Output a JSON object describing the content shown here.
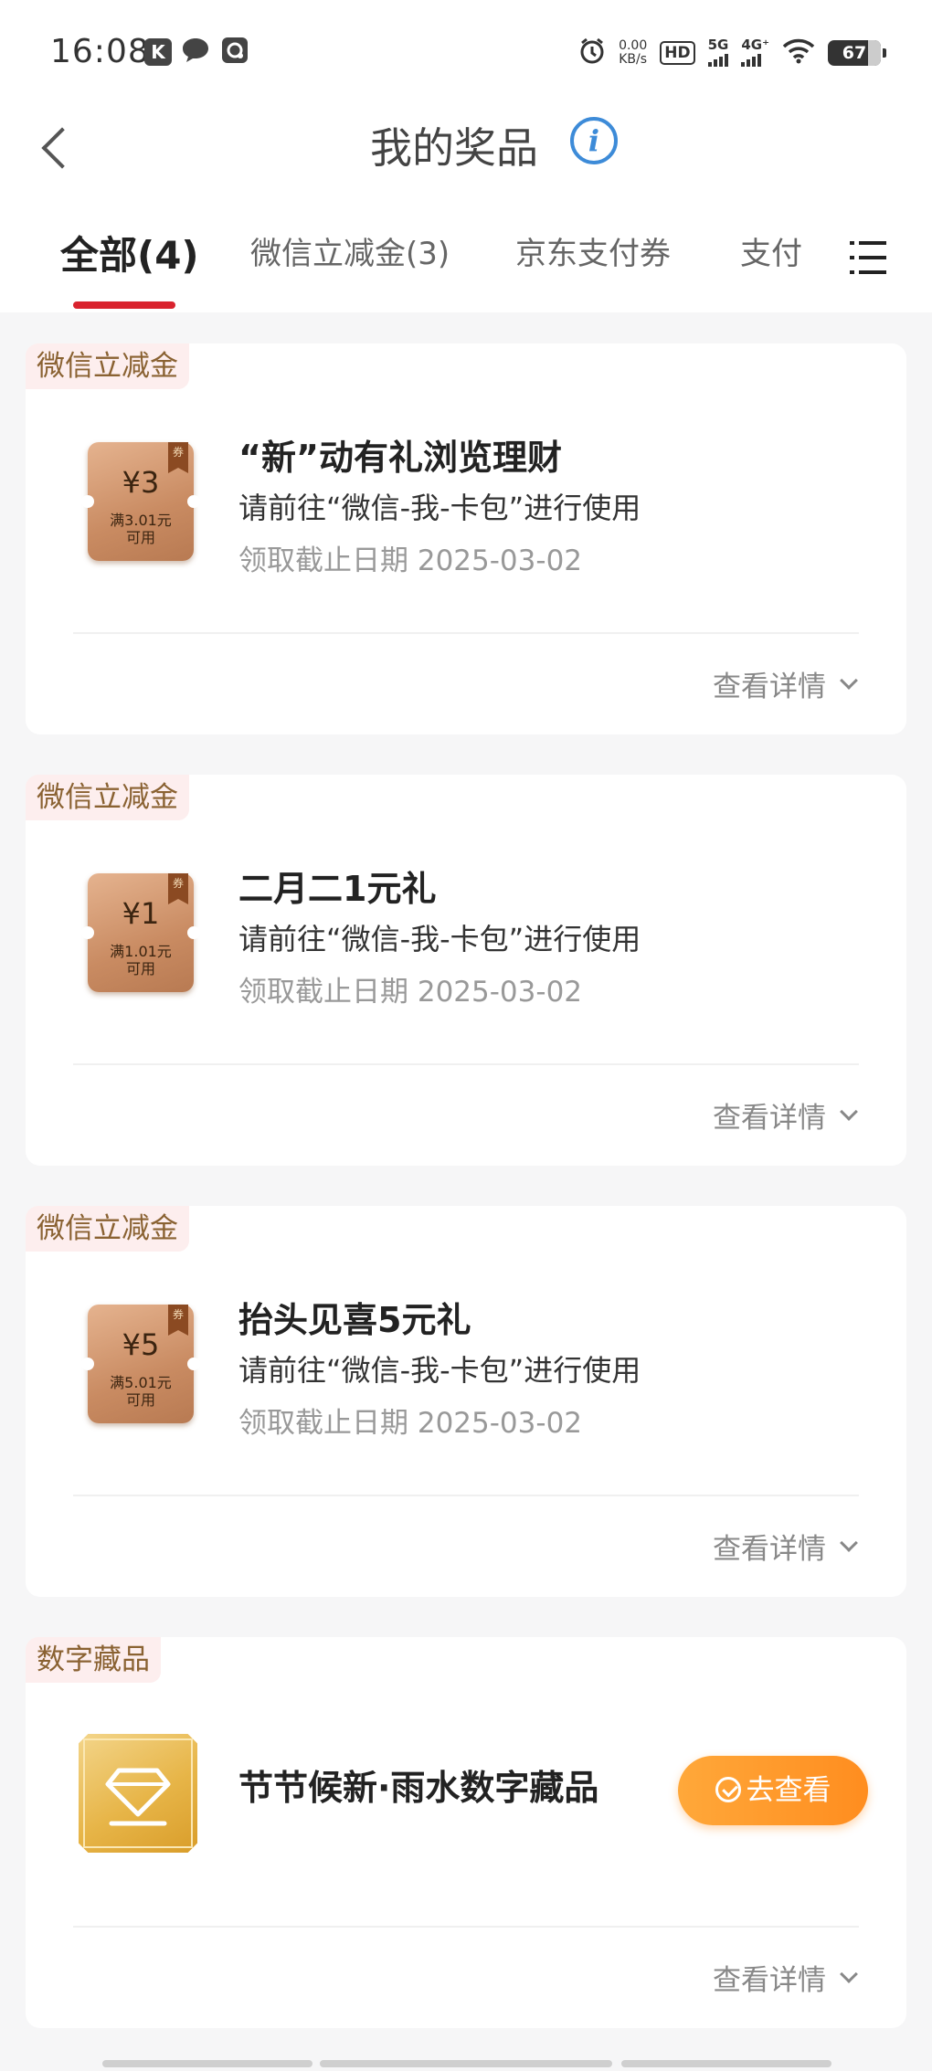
{
  "status_bar": {
    "time": "16:08",
    "net_speed_value": "0.00",
    "net_speed_unit": "KB/s",
    "hd": "HD",
    "signal_1": "5G",
    "signal_2": "4G⁺",
    "battery": "67"
  },
  "header": {
    "title": "我的奖品",
    "info_icon": "i"
  },
  "tabs": [
    {
      "label": "全部(4)",
      "active": true
    },
    {
      "label": "微信立减金(3)",
      "active": false
    },
    {
      "label": "京东支付券",
      "active": false
    },
    {
      "label": "支付",
      "active": false
    }
  ],
  "cards": [
    {
      "badge": "微信立减金",
      "coupon_amount": "¥3",
      "coupon_condition": "满3.01元",
      "coupon_usable": "可用",
      "coupon_tag": "券",
      "title": "“新”动有礼浏览理财",
      "subtitle": "请前往“微信-我-卡包”进行使用",
      "date": "领取截止日期 2025-03-02",
      "detail": "查看详情"
    },
    {
      "badge": "微信立减金",
      "coupon_amount": "¥1",
      "coupon_condition": "满1.01元",
      "coupon_usable": "可用",
      "coupon_tag": "券",
      "title": "二月二1元礼",
      "subtitle": "请前往“微信-我-卡包”进行使用",
      "date": "领取截止日期 2025-03-02",
      "detail": "查看详情"
    },
    {
      "badge": "微信立减金",
      "coupon_amount": "¥5",
      "coupon_condition": "满5.01元",
      "coupon_usable": "可用",
      "coupon_tag": "券",
      "title": "抬头见喜5元礼",
      "subtitle": "请前往“微信-我-卡包”进行使用",
      "date": "领取截止日期 2025-03-02",
      "detail": "查看详情"
    },
    {
      "badge": "数字藏品",
      "title": "节节候新·雨水数字藏品",
      "button": "去查看",
      "detail": "查看详情"
    }
  ],
  "colors": {
    "accent_red": "#d9232e",
    "orange_button": "#ff8d1f",
    "badge_bg": "#fdeeee",
    "badge_text": "#8a6232",
    "info_blue": "#3d8bd8"
  },
  "icons": [
    "back-icon",
    "info-icon",
    "menu-list-icon",
    "chevron-down-icon",
    "check-circle-icon",
    "diamond-icon",
    "alarm-icon",
    "message-icon",
    "wifi-icon"
  ]
}
